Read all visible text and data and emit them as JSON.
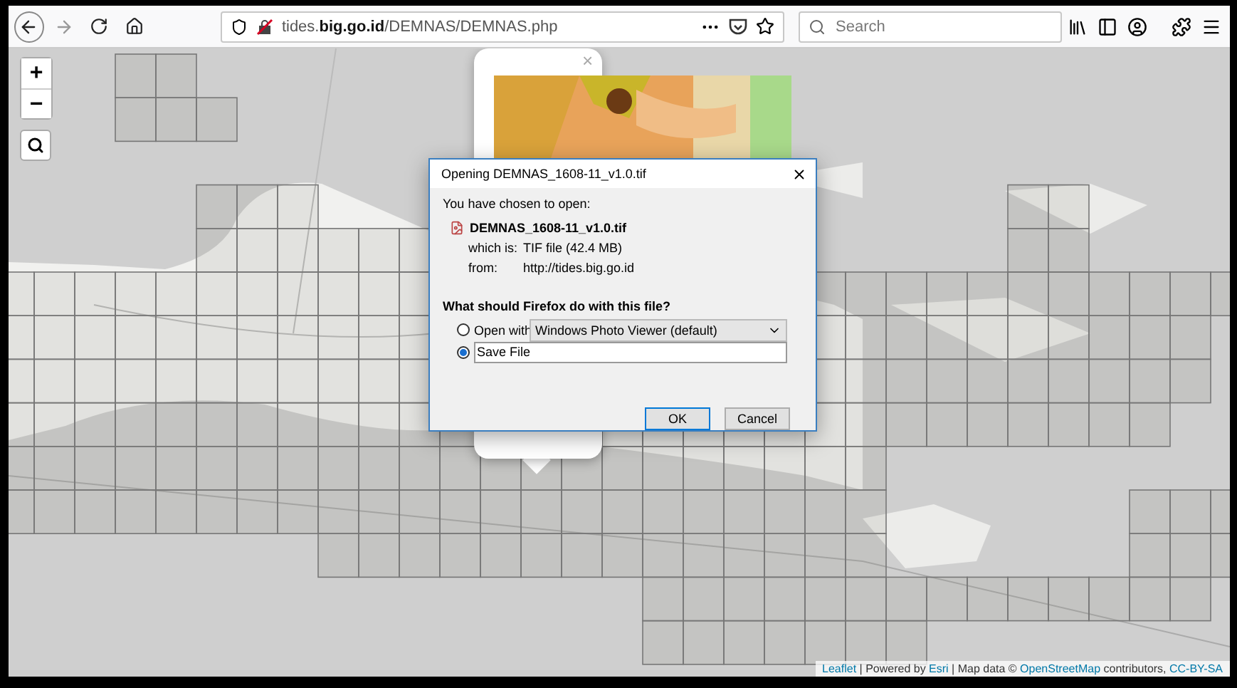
{
  "browser": {
    "url": "tides.**big.go.id**/DEMNAS/DEMNAS.php",
    "search": {
      "placeholder": "Search"
    }
  },
  "map": {
    "zoom_in": "+",
    "zoom_out": "−",
    "popup": {
      "close": "×"
    },
    "attribution": [
      {
        "text": "Leaflet",
        "link": true
      },
      {
        "text": " | Powered by ",
        "link": false
      },
      {
        "text": "Esri",
        "link": true
      },
      {
        "text": " | Map data © ",
        "link": false
      },
      {
        "text": "OpenStreetMap",
        "link": true
      },
      {
        "text": " contributors, ",
        "link": false
      },
      {
        "text": "CC-BY-SA",
        "link": true
      }
    ]
  },
  "dialog": {
    "title": "Opening DEMNAS_1608-11_v1.0.tif",
    "intro": "You have chosen to open:",
    "filename": "DEMNAS_1608-11_v1.0.tif",
    "details": [
      {
        "label": "which is:",
        "value": "TIF file (42.4 MB)"
      },
      {
        "label": "from:",
        "value": "http://tides.big.go.id"
      }
    ],
    "question": "What should Firefox do with this file?",
    "options": [
      {
        "kind": "open_with",
        "label": "Open with",
        "selected": false,
        "app": "Windows Photo Viewer (default)"
      },
      {
        "kind": "save",
        "label": "Save File",
        "selected": true
      }
    ],
    "buttons": [
      {
        "label": "OK",
        "default": true
      },
      {
        "label": "Cancel",
        "default": false
      }
    ]
  }
}
